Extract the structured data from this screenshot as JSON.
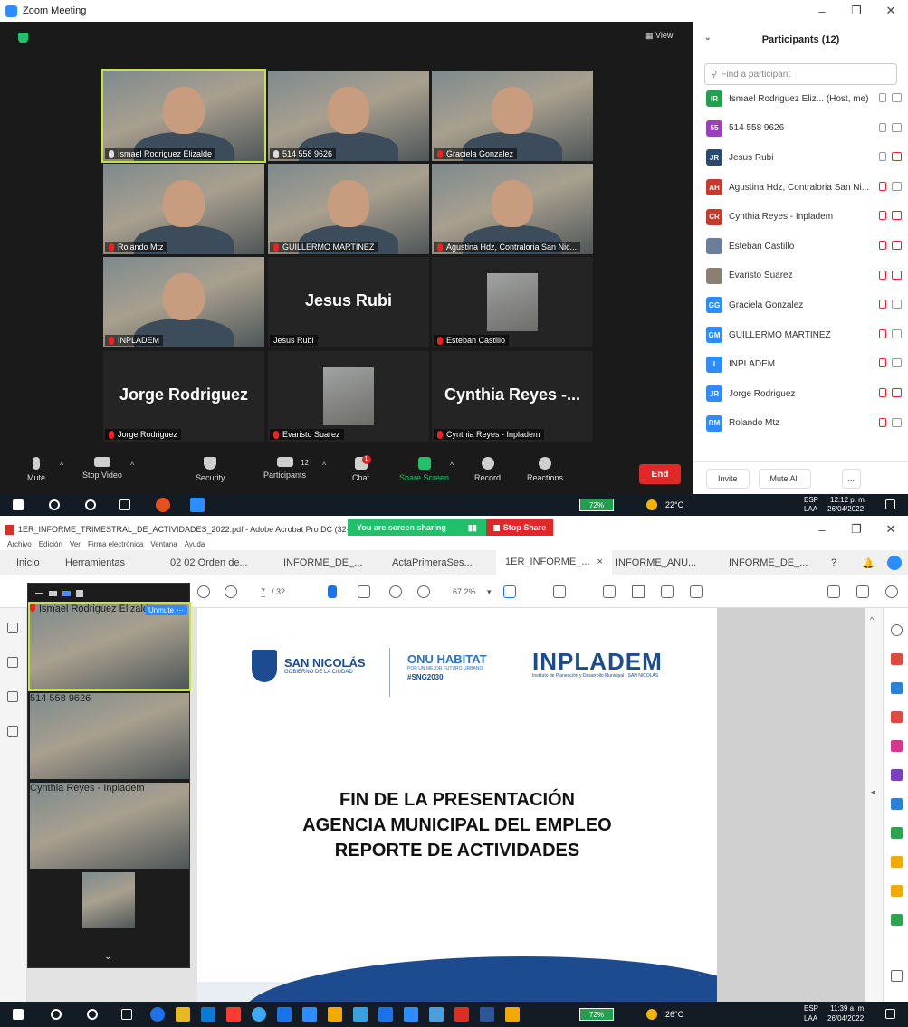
{
  "zoom": {
    "window_title": "Zoom Meeting",
    "view_label": "View",
    "tiles": [
      {
        "name": "Ismael Rodriguez Elizalde",
        "video": true,
        "muted": false,
        "active": true
      },
      {
        "name": "514 558 9626",
        "video": true,
        "muted": false
      },
      {
        "name": "Graciela Gonzalez",
        "video": true,
        "muted": true
      },
      {
        "name": "Rolando Mtz",
        "video": true,
        "muted": true
      },
      {
        "name": "GUILLERMO MARTINEZ",
        "video": true,
        "muted": true
      },
      {
        "name": "Agustina Hdz, Contraloria San Nic...",
        "video": true,
        "muted": true
      },
      {
        "name": "INPLADEM",
        "video": true,
        "muted": true
      },
      {
        "name": "Jesus Rubi",
        "big": "Jesus Rubi",
        "video": false,
        "muted": false
      },
      {
        "name": "Esteban Castillo",
        "video": false,
        "thumb": true,
        "muted": true
      },
      {
        "name": "Jorge Rodriguez",
        "big": "Jorge Rodriguez",
        "video": false,
        "muted": true
      },
      {
        "name": "Evaristo Suarez",
        "video": false,
        "thumb": true,
        "muted": true
      },
      {
        "name": "Cynthia Reyes - Inpladem",
        "big": "Cynthia Reyes -...",
        "video": false,
        "muted": true
      }
    ],
    "toolbar": {
      "mute": "Mute",
      "stop_video": "Stop Video",
      "security": "Security",
      "participants": "Participants",
      "participants_count": "12",
      "chat": "Chat",
      "chat_badge": "1",
      "share_screen": "Share Screen",
      "record": "Record",
      "reactions": "Reactions",
      "end": "End"
    },
    "participants_panel": {
      "title": "Participants (12)",
      "search_placeholder": "Find a participant",
      "invite": "Invite",
      "mute_all": "Mute All",
      "more": "...",
      "list": [
        {
          "initials": "IR",
          "color": "#23a04e",
          "name": "Ismael Rodriguez Eliz... (Host, me)",
          "mic_muted": false,
          "video_off": false
        },
        {
          "initials": "55",
          "color": "#9b3fc1",
          "name": "514 558 9626",
          "mic_muted": false,
          "video_off": false
        },
        {
          "initials": "JR",
          "color": "#2b4a6f",
          "name": "Jesus Rubi",
          "mic_muted": false,
          "video_off": true
        },
        {
          "initials": "AH",
          "color": "#c53a2a",
          "name": "Agustina Hdz, Contraloria San Ni...",
          "mic_muted": true,
          "video_off": false
        },
        {
          "initials": "CR",
          "color": "#c53a2a",
          "name": "Cynthia Reyes - Inpladem",
          "mic_muted": true,
          "video_off": true
        },
        {
          "initials": "",
          "color": "#6b7f9a",
          "name": "Esteban Castillo",
          "mic_muted": true,
          "video_off": true
        },
        {
          "initials": "",
          "color": "#8a8072",
          "name": "Evaristo Suarez",
          "mic_muted": true,
          "video_off": true
        },
        {
          "initials": "GG",
          "color": "#2d8cff",
          "name": "Graciela Gonzalez",
          "mic_muted": true,
          "video_off": false
        },
        {
          "initials": "GM",
          "color": "#2d8cff",
          "name": "GUILLERMO MARTINEZ",
          "mic_muted": true,
          "video_off": false
        },
        {
          "initials": "I",
          "color": "#2d8cff",
          "name": "INPLADEM",
          "mic_muted": true,
          "video_off": false
        },
        {
          "initials": "JR",
          "color": "#2d8cff",
          "name": "Jorge Rodriguez",
          "mic_muted": true,
          "video_off": true
        },
        {
          "initials": "RM",
          "color": "#2d8cff",
          "name": "Rolando Mtz",
          "mic_muted": true,
          "video_off": false
        }
      ]
    }
  },
  "taskbar_top": {
    "battery": "72%",
    "weather": "22°C",
    "lang1": "ESP",
    "lang2": "LAA",
    "time": "12:12 p. m.",
    "date": "26/04/2022"
  },
  "taskbar_bottom": {
    "battery": "72%",
    "weather": "26°C",
    "lang1": "ESP",
    "lang2": "LAA",
    "time": "11:39 a. m.",
    "date": "26/04/2022"
  },
  "acrobat": {
    "window_title": "1ER_INFORME_TRIMESTRAL_DE_ACTIVIDADES_2022.pdf - Adobe Acrobat Pro DC (32-bi",
    "sharing_label": "You are screen sharing",
    "stop_share": "Stop Share",
    "menu": [
      "Archivo",
      "Edición",
      "Ver",
      "Firma electrónica",
      "Ventana",
      "Ayuda"
    ],
    "tabs": [
      "Inicio",
      "Herramientas",
      "02 02 Orden de...",
      "INFORME_DE_...",
      "ActaPrimeraSes...",
      "1ER_INFORME_...",
      "INFORME_ANU...",
      "INFORME_DE_..."
    ],
    "selected_tab": "1ER_INFORME_...",
    "page_current": "7",
    "page_total": "/ 32",
    "zoom": "67.2%",
    "logos": {
      "san_nicolas": "SAN NICOLÁS",
      "san_nicolas_sub": "GOBIERNO DE LA CIUDAD",
      "onu": "ONU HABITAT",
      "onu_sub": "POR UN MEJOR FUTURO URBANO",
      "hashtag": "#SNG2030",
      "inpladem": "INPLADEM",
      "inpladem_sub": "Instituto de Planeación y Desarrollo Municipal · SAN NICOLÁS"
    },
    "slide_lines": [
      "FIN DE LA PRESENTACIÓN",
      "AGENCIA MUNICIPAL DEL EMPLEO",
      "REPORTE DE ACTIVIDADES"
    ]
  },
  "float_panel": {
    "unmute": "Unmute",
    "tiles": [
      "Ismael Rodriguez Elizalde",
      "514 558 9626",
      "Cynthia Reyes - Inpladem",
      ""
    ]
  }
}
